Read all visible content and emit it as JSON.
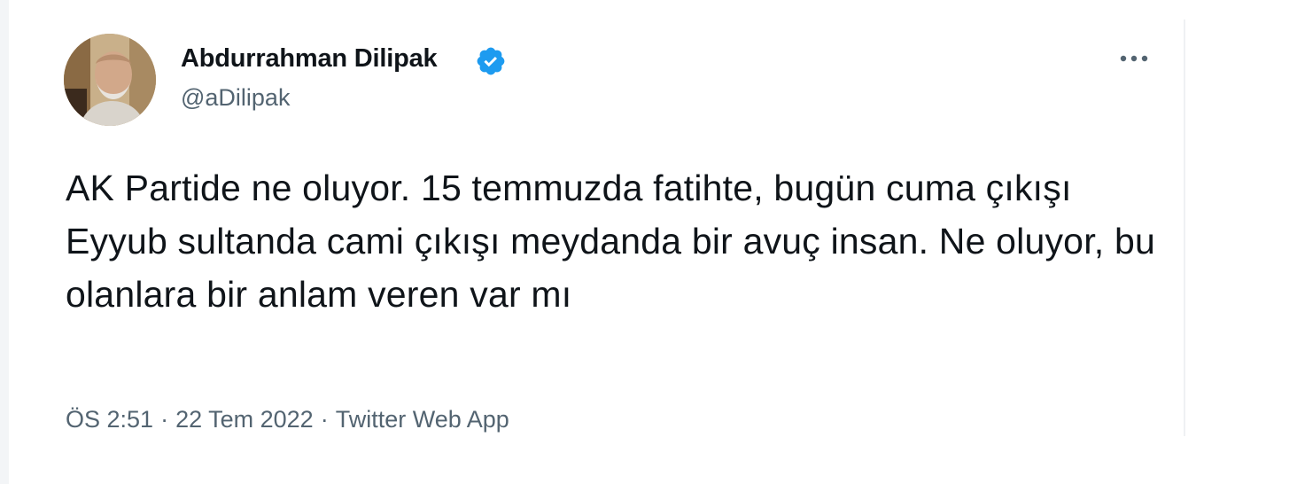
{
  "tweet": {
    "author_name": "Abdurrahman Dilipak",
    "handle": "@aDilipak",
    "verified": true,
    "text": "AK Partide ne oluyor. 15 temmuzda fatihte, bugün cuma çıkışı Eyyub sultanda cami çıkışı meydanda bir avuç insan. Ne oluyor, bu olanlara bir anlam veren var mı",
    "time": "ÖS 2:51",
    "separator": "·",
    "date": "22 Tem 2022",
    "source": "Twitter Web App"
  },
  "icons": {
    "verified": "verified-badge-icon",
    "more": "more-horizontal-icon"
  },
  "colors": {
    "verified_badge": "#1d9bf0",
    "primary_text": "#0f1419",
    "secondary_text": "#536471"
  }
}
